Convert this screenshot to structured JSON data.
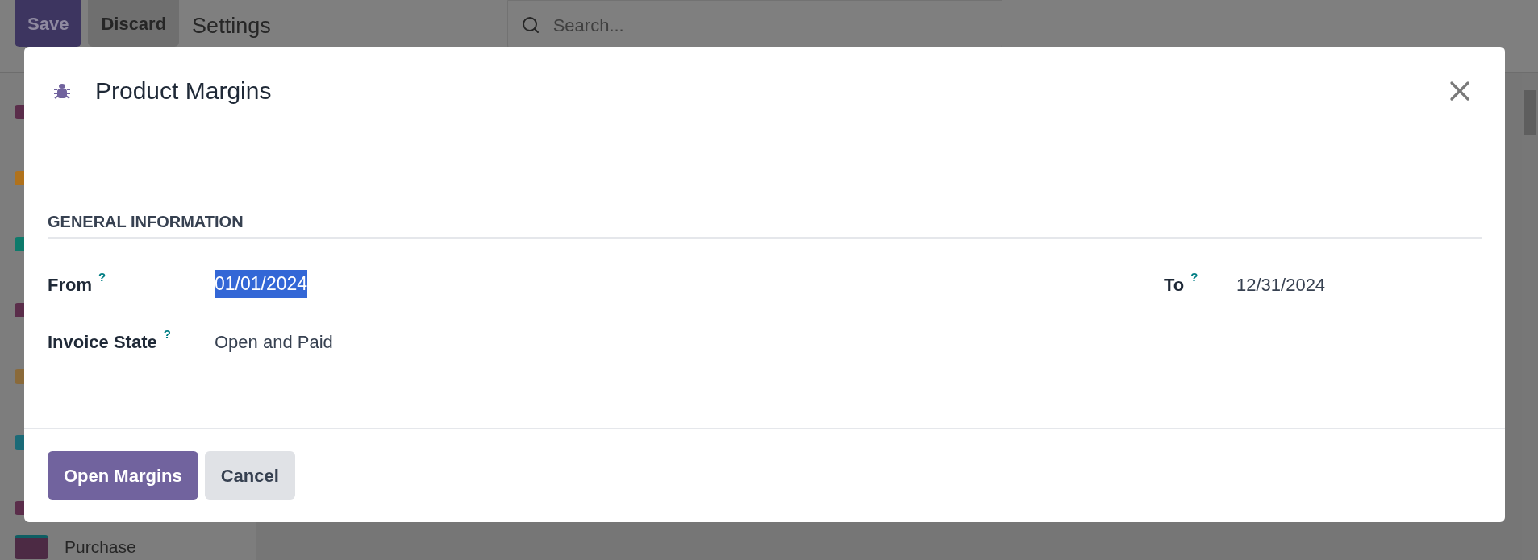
{
  "top_bar": {
    "buttons": [
      {
        "label": "Save",
        "kind": "primary"
      },
      {
        "label": "Discard",
        "kind": "secondary"
      }
    ],
    "title": "Settings",
    "search": {
      "placeholder": "Search..."
    }
  },
  "sidebar": {
    "items": [
      {
        "label": "Purchase"
      }
    ]
  },
  "dialog": {
    "title": "Product Margins",
    "section": "GENERAL INFORMATION",
    "fields": [
      {
        "label": "From",
        "help": "?",
        "value": "01/01/2024",
        "kind": "input",
        "focused": true
      },
      {
        "label": "To",
        "help": "?",
        "value": "12/31/2024",
        "kind": "text",
        "focused": false
      },
      {
        "label": "Invoice State",
        "help": "?",
        "value": "Open and Paid",
        "kind": "text",
        "focused": false
      }
    ],
    "buttons": [
      {
        "label": "Open Margins",
        "kind": "primary"
      },
      {
        "label": "Cancel",
        "kind": "secondary"
      }
    ]
  }
}
